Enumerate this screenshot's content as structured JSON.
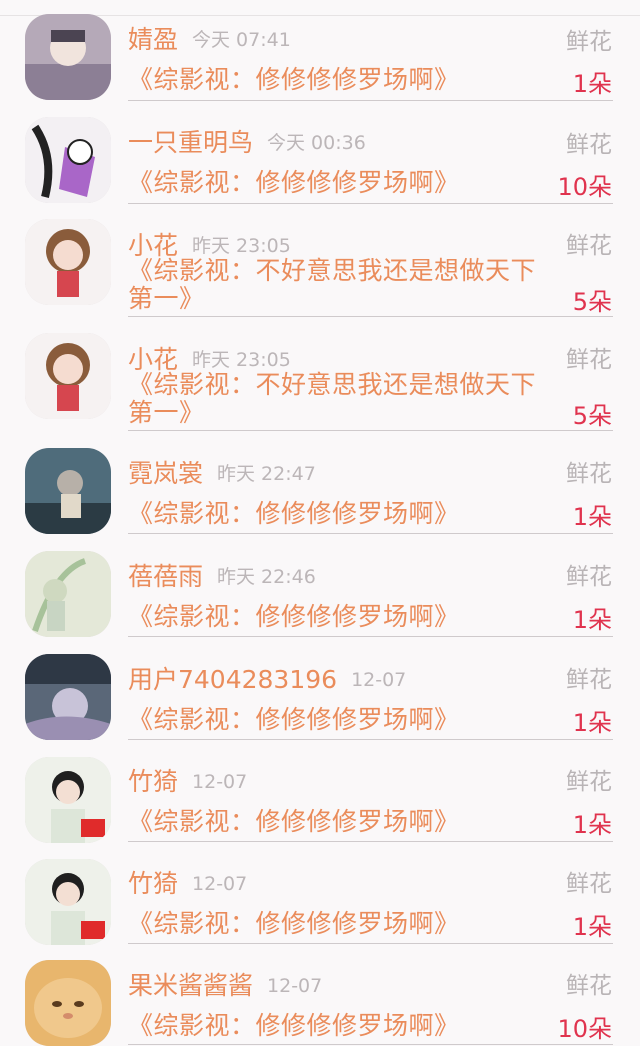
{
  "gift_label": "鲜花",
  "entries": [
    {
      "name": "婧盈",
      "time": "今天 07:41",
      "title": "《综影视：修修修修罗场啊》",
      "count": "1朵"
    },
    {
      "name": "一只重明鸟",
      "time": "今天 00:36",
      "title": "《综影视：修修修修罗场啊》",
      "count": "10朵"
    },
    {
      "name": "小花",
      "time": "昨天 23:05",
      "title": "《综影视：不好意思我还是想做天下第一》",
      "count": "5朵"
    },
    {
      "name": "小花",
      "time": "昨天 23:05",
      "title": "《综影视：不好意思我还是想做天下第一》",
      "count": "5朵"
    },
    {
      "name": "霓岚裳",
      "time": "昨天 22:47",
      "title": "《综影视：修修修修罗场啊》",
      "count": "1朵"
    },
    {
      "name": "蓓蓓雨",
      "time": "昨天 22:46",
      "title": "《综影视：修修修修罗场啊》",
      "count": "1朵"
    },
    {
      "name": "用户7404283196",
      "time": "12-07",
      "title": "《综影视：修修修修罗场啊》",
      "count": "1朵"
    },
    {
      "name": "竹猗",
      "time": "12-07",
      "title": "《综影视：修修修修罗场啊》",
      "count": "1朵"
    },
    {
      "name": "竹猗",
      "time": "12-07",
      "title": "《综影视：修修修修罗场啊》",
      "count": "1朵"
    },
    {
      "name": "果米酱酱酱",
      "time": "12-07",
      "title": "《综影视：修修修修罗场啊》",
      "count": "10朵"
    }
  ],
  "colors": {
    "name": "#ea8c5b",
    "count": "#e0334e",
    "muted": "#bcb6b8"
  }
}
